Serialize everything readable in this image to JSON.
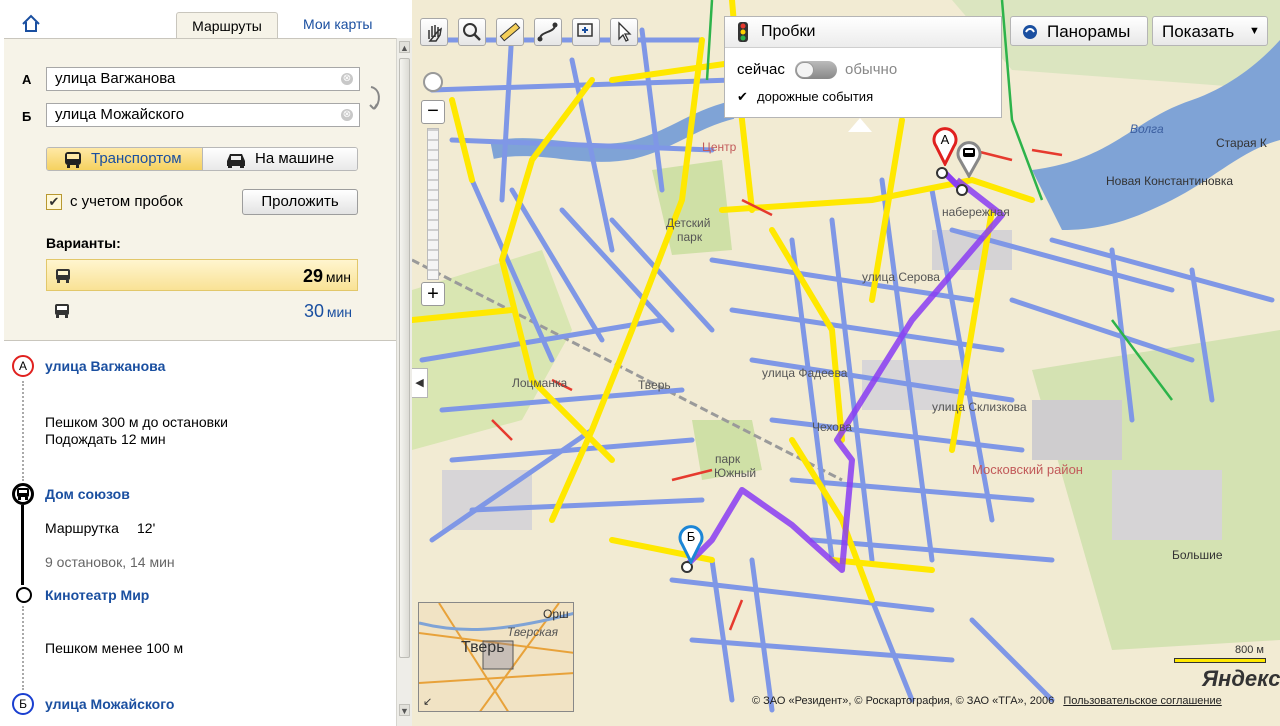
{
  "colors": {
    "accent": "#1a4fa0",
    "route": "#8a3cf2",
    "highlight": "#f4cf59",
    "road": "#7f97e6",
    "traffic_yellow": "#ffe800",
    "traffic_red": "#e63a2e",
    "traffic_green": "#2db34a"
  },
  "sidebar": {
    "tabs": {
      "routes": "Маршруты",
      "my_maps": "Мои карты"
    },
    "point_a": {
      "label": "А",
      "value": "улица Вагжанова"
    },
    "point_b": {
      "label": "Б",
      "value": "улица Можайского"
    },
    "clear_glyph": "⊗",
    "modes": {
      "transport": "Транспортом",
      "car": "На машине"
    },
    "traffic_check": {
      "checked": true,
      "mark": "✔",
      "label": "с учетом пробок"
    },
    "build_button": "Проложить",
    "variants_label": "Варианты:",
    "variants": [
      {
        "icon": "bus-icon",
        "value": "29",
        "unit": "мин"
      },
      {
        "icon": "bus-icon",
        "value": "30",
        "unit": "мин"
      }
    ],
    "steps": {
      "start": {
        "marker": "А",
        "name": "улица Вагжанова"
      },
      "walk1": "Пешком 300 м до остановки",
      "wait": "Подождать 12 мин",
      "stop1": {
        "name": "Дом союзов"
      },
      "ride": {
        "type": "Маршрутка",
        "number": "12'"
      },
      "ride_info": "9 остановок, 14 мин",
      "stop2": {
        "name": "Кинотеатр Мир"
      },
      "walk2": "Пешком менее 100 м",
      "end": {
        "marker": "Б",
        "name": "улица Можайского"
      }
    }
  },
  "map": {
    "traffic": {
      "title": "Пробки",
      "now": "сейчас",
      "usual": "обычно",
      "events_mark": "✔",
      "events": "дорожные события"
    },
    "panoramas": "Панорамы",
    "show": "Показать",
    "show_arrow": "▼",
    "collapse_arrow": "◀",
    "labels": {
      "center": "Центр",
      "detsky": "Детский",
      "park": "парк",
      "lotsmanka": "Лоцманка",
      "tver_station": "Тверь",
      "park2": "парк",
      "yuzhny": "Южный",
      "moskovsky": "Московский район",
      "novaya_konst": "Новая Константиновка",
      "staraya": "Старая К",
      "volga": "Волга",
      "bolshie": "Большие",
      "street_fadeeva": "улица Фадеева",
      "street_sklizkova": "улица Склизкова",
      "street_seraya": "улица Серова",
      "naberezhnaya": "набережная",
      "chekhova": "Чехова"
    },
    "minimap": {
      "city": "Тверь",
      "region": "Тверская",
      "corner": "Орш"
    },
    "scale": "800 м",
    "brand": "Яндекс",
    "copyright": "© ЗАО «Резидент», © Роскартография, © ЗАО «ТГА», 2006",
    "agreement": "Пользовательское соглашение",
    "markers": {
      "a": "А",
      "b": "Б"
    }
  }
}
